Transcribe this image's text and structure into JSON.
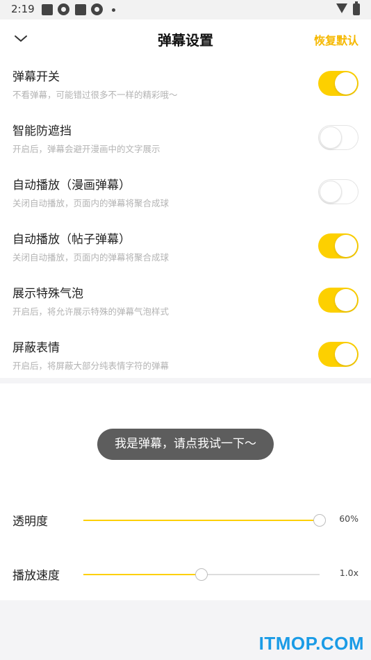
{
  "status_bar": {
    "time": "2:19"
  },
  "header": {
    "title": "弹幕设置",
    "reset_label": "恢复默认"
  },
  "settings": [
    {
      "label": "弹幕开关",
      "desc": "不看弹幕，可能错过很多不一样的精彩哦～",
      "enabled": true
    },
    {
      "label": "智能防遮挡",
      "desc": "开启后，弹幕会避开漫画中的文字展示",
      "enabled": false
    },
    {
      "label": "自动播放（漫画弹幕）",
      "desc": "关闭自动播放，页面内的弹幕将聚合成球",
      "enabled": false
    },
    {
      "label": "自动播放（帖子弹幕）",
      "desc": "关闭自动播放，页面内的弹幕将聚合成球",
      "enabled": true
    },
    {
      "label": "展示特殊气泡",
      "desc": "开启后，将允许展示特殊的弹幕气泡样式",
      "enabled": true
    },
    {
      "label": "屏蔽表情",
      "desc": "开启后，将屏蔽大部分纯表情字符的弹幕",
      "enabled": true
    }
  ],
  "preview": {
    "danmaku_text": "我是弹幕，请点我试一下～"
  },
  "sliders": {
    "opacity": {
      "label": "透明度",
      "value_text": "60%",
      "fraction": 1.0
    },
    "speed": {
      "label": "播放速度",
      "value_text": "1.0x",
      "fraction": 0.5
    }
  },
  "watermark": "ITMOP.COM",
  "colors": {
    "accent": "#fdd000",
    "reset": "#f5b800",
    "bubble": "#5d5d5d",
    "watermark": "#1a9be6"
  },
  "icons": {
    "back": "chevron-down-icon"
  }
}
